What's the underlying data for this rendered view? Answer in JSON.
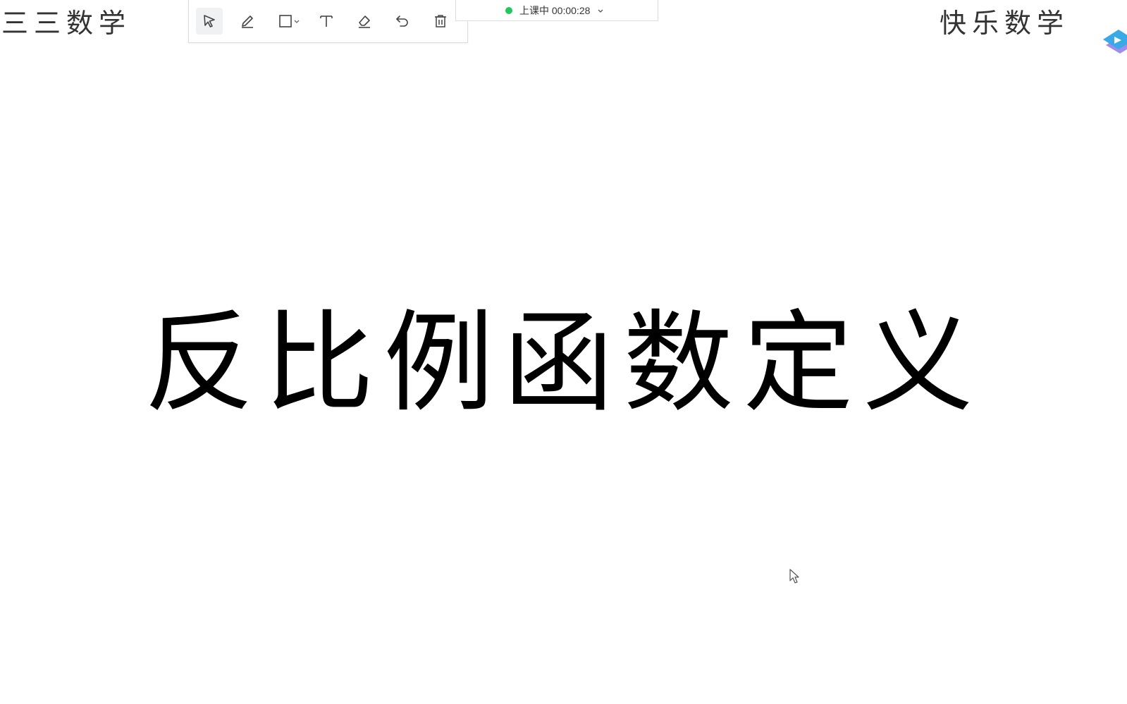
{
  "header": {
    "left_text": "三三数学",
    "right_text": "快乐数学"
  },
  "toolbar": {
    "tools": [
      {
        "name": "select-cursor-icon",
        "active": true
      },
      {
        "name": "pen-icon",
        "active": false
      },
      {
        "name": "rectangle-shape-icon",
        "active": false
      },
      {
        "name": "text-icon",
        "active": false
      },
      {
        "name": "eraser-icon",
        "active": false
      },
      {
        "name": "undo-icon",
        "active": false
      },
      {
        "name": "trash-icon",
        "active": false
      }
    ]
  },
  "status": {
    "text": "上课中 00:00:28",
    "dot_color": "#22c55e"
  },
  "main": {
    "title": "反比例函数定义"
  },
  "colors": {
    "badge_primary": "#3aa9e6",
    "badge_secondary": "#8b7ae6"
  }
}
